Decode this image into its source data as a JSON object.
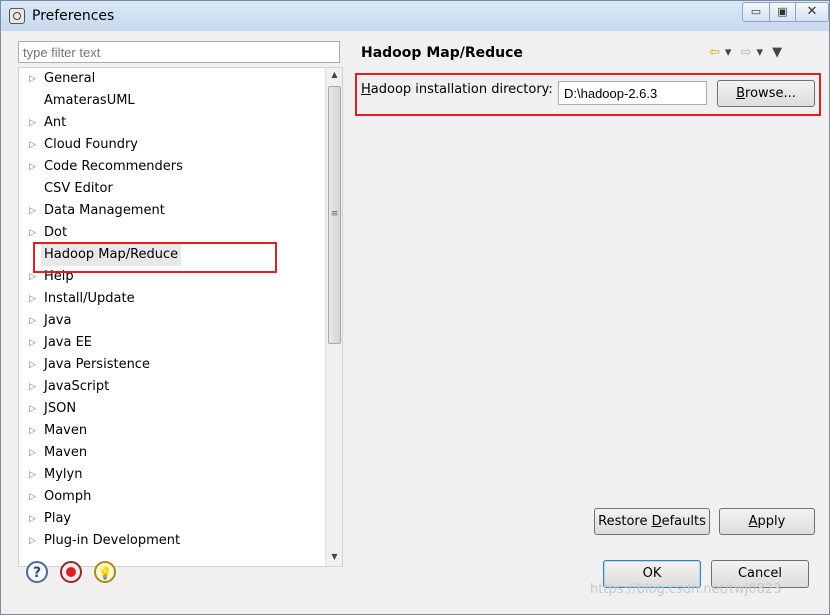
{
  "window": {
    "title": "Preferences",
    "minimize_glyph": "▭",
    "maximize_glyph": "▣",
    "close_glyph": "✕"
  },
  "filter": {
    "placeholder": "type filter text"
  },
  "tree": {
    "items": [
      {
        "label": "General",
        "expandable": true
      },
      {
        "label": "AmaterasUML",
        "expandable": false
      },
      {
        "label": "Ant",
        "expandable": true
      },
      {
        "label": "Cloud Foundry",
        "expandable": true
      },
      {
        "label": "Code Recommenders",
        "expandable": true
      },
      {
        "label": "CSV Editor",
        "expandable": false
      },
      {
        "label": "Data Management",
        "expandable": true
      },
      {
        "label": "Dot",
        "expandable": true
      },
      {
        "label": "Hadoop Map/Reduce",
        "expandable": false,
        "selected": true
      },
      {
        "label": "Help",
        "expandable": true
      },
      {
        "label": "Install/Update",
        "expandable": true
      },
      {
        "label": "Java",
        "expandable": true
      },
      {
        "label": "Java EE",
        "expandable": true
      },
      {
        "label": "Java Persistence",
        "expandable": true
      },
      {
        "label": "JavaScript",
        "expandable": true
      },
      {
        "label": "JSON",
        "expandable": true
      },
      {
        "label": "Maven",
        "expandable": true
      },
      {
        "label": "Maven",
        "expandable": true
      },
      {
        "label": "Mylyn",
        "expandable": true
      },
      {
        "label": "Oomph",
        "expandable": true
      },
      {
        "label": "Play",
        "expandable": true
      },
      {
        "label": "Plug-in Development",
        "expandable": true
      }
    ],
    "arrow_glyph": "▷"
  },
  "page": {
    "title": "Hadoop Map/Reduce",
    "dir_label_mnemonic": "H",
    "dir_label_rest": "adoop installation directory:",
    "dir_value": "D:\\hadoop-2.6.3",
    "browse_mnemonic": "B",
    "browse_rest": "rowse...",
    "restore_prefix": "Restore ",
    "restore_mnemonic": "D",
    "restore_suffix": "efaults",
    "apply_mnemonic": "A",
    "apply_rest": "pply"
  },
  "nav": {
    "back": "⇦",
    "dropdown": "▾",
    "forward": "⇨",
    "menu": "▼"
  },
  "footer": {
    "ok_label": "OK",
    "cancel_label": "Cancel",
    "help_glyph": "?",
    "bulb_glyph": "💡"
  },
  "watermark": "https://blog.csdn.net/twj0823",
  "colors": {
    "highlight_box": "#e02020",
    "title_bar": "#c7d9ee",
    "selection": "#e8e8e8"
  }
}
